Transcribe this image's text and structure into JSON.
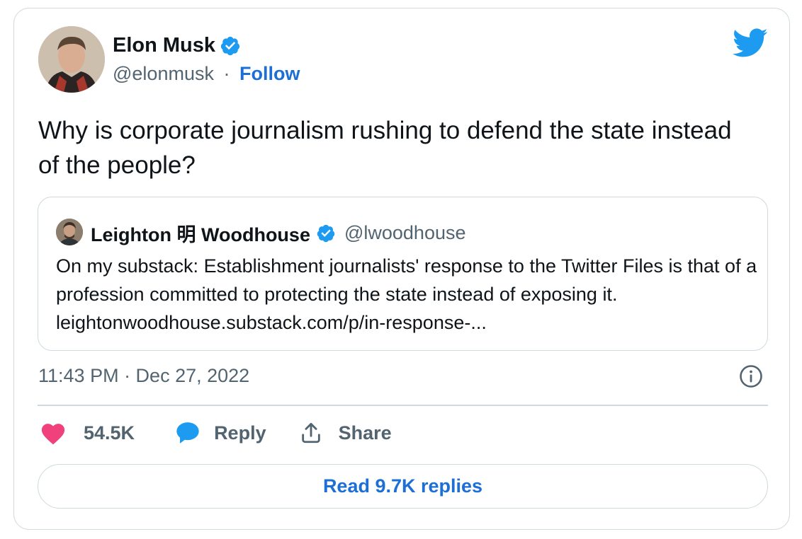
{
  "author": {
    "name": "Elon Musk",
    "handle": "@elonmusk",
    "separator": "·",
    "follow_label": "Follow"
  },
  "tweet": {
    "text": "Why is corporate journalism rushing to defend the state instead of the people?",
    "timestamp": "11:43 PM · Dec 27, 2022"
  },
  "quoted_tweet": {
    "name": "Leighton 明 Woodhouse",
    "handle": "@lwoodhouse",
    "text": "On my substack: Establishment journalists' response to the Twitter Files is that of a profession committed to protecting the state instead of exposing it. leightonwoodhouse.substack.com/p/in-response-..."
  },
  "actions": {
    "like_count": "54.5K",
    "reply_label": "Reply",
    "share_label": "Share"
  },
  "read_replies_label": "Read 9.7K replies",
  "icons": {
    "logo": "twitter-bird-icon",
    "verified": "verified-badge-icon",
    "info": "info-icon",
    "like": "heart-icon",
    "reply": "reply-bubble-icon",
    "share": "share-icon"
  },
  "colors": {
    "verified_blue": "#1d9bf0",
    "link_blue": "#1d6fd6",
    "heart_pink": "#f0417c",
    "muted_text": "#536471",
    "border": "#cfd9de"
  }
}
